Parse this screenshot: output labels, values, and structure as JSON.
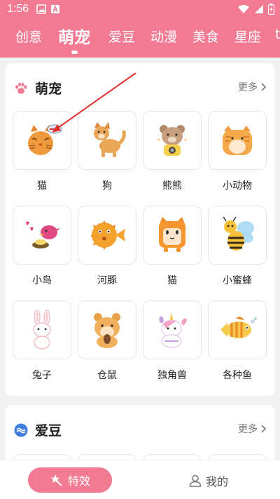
{
  "status_bar": {
    "time": "1:56"
  },
  "tabs": [
    {
      "label": "创意"
    },
    {
      "label": "萌宠",
      "active": true
    },
    {
      "label": "爱豆"
    },
    {
      "label": "动漫"
    },
    {
      "label": "美食"
    },
    {
      "label": "星座"
    },
    {
      "label": "t"
    }
  ],
  "pets_section": {
    "title": "萌宠",
    "more_label": "更多",
    "items": [
      {
        "label": "猫",
        "icon": "cat-sticker-icon"
      },
      {
        "label": "狗",
        "icon": "dog-sticker-icon"
      },
      {
        "label": "熊熊",
        "icon": "bear-sticker-icon"
      },
      {
        "label": "小动物",
        "icon": "small-animal-sticker-icon"
      },
      {
        "label": "小鸟",
        "icon": "bird-sticker-icon"
      },
      {
        "label": "河豚",
        "icon": "pufferfish-sticker-icon"
      },
      {
        "label": "猫",
        "icon": "box-cat-sticker-icon"
      },
      {
        "label": "小蜜蜂",
        "icon": "bee-sticker-icon"
      },
      {
        "label": "兔子",
        "icon": "rabbit-sticker-icon"
      },
      {
        "label": "仓鼠",
        "icon": "hamster-sticker-icon"
      },
      {
        "label": "独角兽",
        "icon": "unicorn-sticker-icon"
      },
      {
        "label": "各种鱼",
        "icon": "fish-sticker-icon"
      }
    ]
  },
  "idols_section": {
    "title": "爱豆",
    "more_label": "更多"
  },
  "bottom_nav": {
    "effects_label": "特效",
    "mine_label": "我的"
  },
  "colors": {
    "accent": "#f27a92",
    "arrow": "#e03030"
  }
}
